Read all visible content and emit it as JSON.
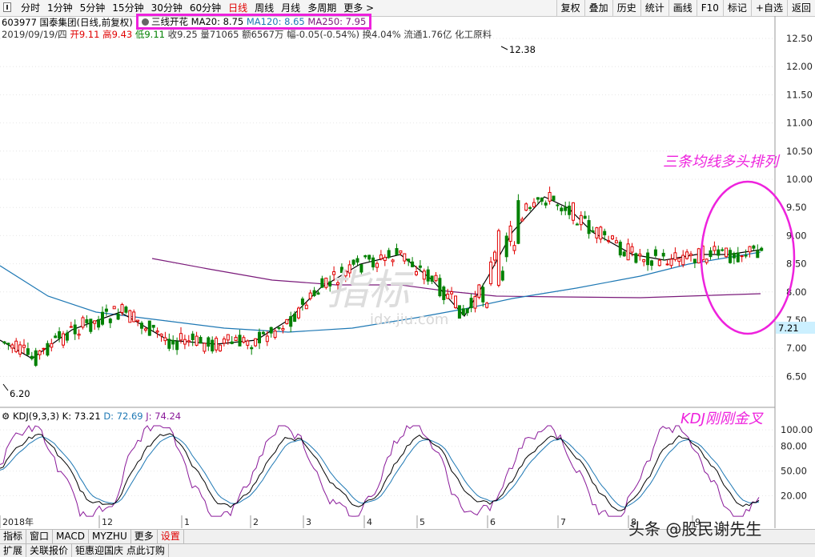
{
  "toolbar": {
    "periods": [
      "分时",
      "1分钟",
      "5分钟",
      "15分钟",
      "30分钟",
      "60分钟",
      "日线",
      "周线",
      "月线",
      "多周期",
      "更多 >"
    ],
    "active_index": 6,
    "right_tools": [
      "复权",
      "叠加",
      "历史",
      "统计",
      "画线",
      "F10",
      "标记",
      "+自选",
      "返回"
    ]
  },
  "header": {
    "stock": "603977 国泰集团(日线,前复权)",
    "ma_title": "三线开花",
    "ma20": "MA20: 8.75",
    "ma120": "MA120: 8.65",
    "ma250": "MA250: 7.95",
    "info_date": "2019/09/19/四",
    "info_open": "开9.11",
    "info_high": "高9.43",
    "info_low": "低9.11",
    "info_close": "收9.25",
    "info_vol": "量71065",
    "info_amt": "额6567万",
    "info_chg": "幅-0.05(-0.54%)",
    "info_turnover": "换4.04%",
    "info_float": "流通1.76亿",
    "info_industry": "化工原料"
  },
  "kdj": {
    "title": "KDJ(9,3,3)",
    "k": "K: 73.21",
    "d": "D: 72.69",
    "j": "J: 74.24",
    "axis": [
      "100.00",
      "80.00",
      "50.00",
      "20.00"
    ]
  },
  "annotations": {
    "ma_note": "三条均线多头排列",
    "kdj_note": "KDJ刚刚金叉"
  },
  "colors": {
    "up": "#e00000",
    "down": "#008000",
    "ma20": "#000000",
    "ma120": "#1e78b4",
    "ma250": "#7a1a7a",
    "highlight": "#ee22dd",
    "price_tag": "#ccf0ff"
  },
  "chart_data": {
    "type": "candlestick",
    "y_axis": [
      "12.50",
      "12.00",
      "11.50",
      "11.00",
      "10.50",
      "10.00",
      "9.50",
      "9.00",
      "8.50",
      "8.00",
      "7.50",
      "7.00",
      "6.50"
    ],
    "ylim": [
      6.2,
      12.7
    ],
    "x_labels": [
      "2018年",
      "12",
      "1",
      "2",
      "3",
      "4",
      "5",
      "6",
      "7",
      "8",
      "9"
    ],
    "high_label": "12.38",
    "low_label": "6.20",
    "current_price": "7.21",
    "grid": true
  },
  "bottom": {
    "tabs": [
      "指标",
      "窗口",
      "MACD",
      "MYZHU",
      "更多",
      "设置"
    ],
    "tabs2": [
      "扩展",
      "关联报价",
      "钜惠迎国庆 点此订购"
    ]
  },
  "watermark": {
    "text": "头条 @股民谢先生",
    "center_logo": "指标",
    "center_site": "idx.jiu.com"
  }
}
